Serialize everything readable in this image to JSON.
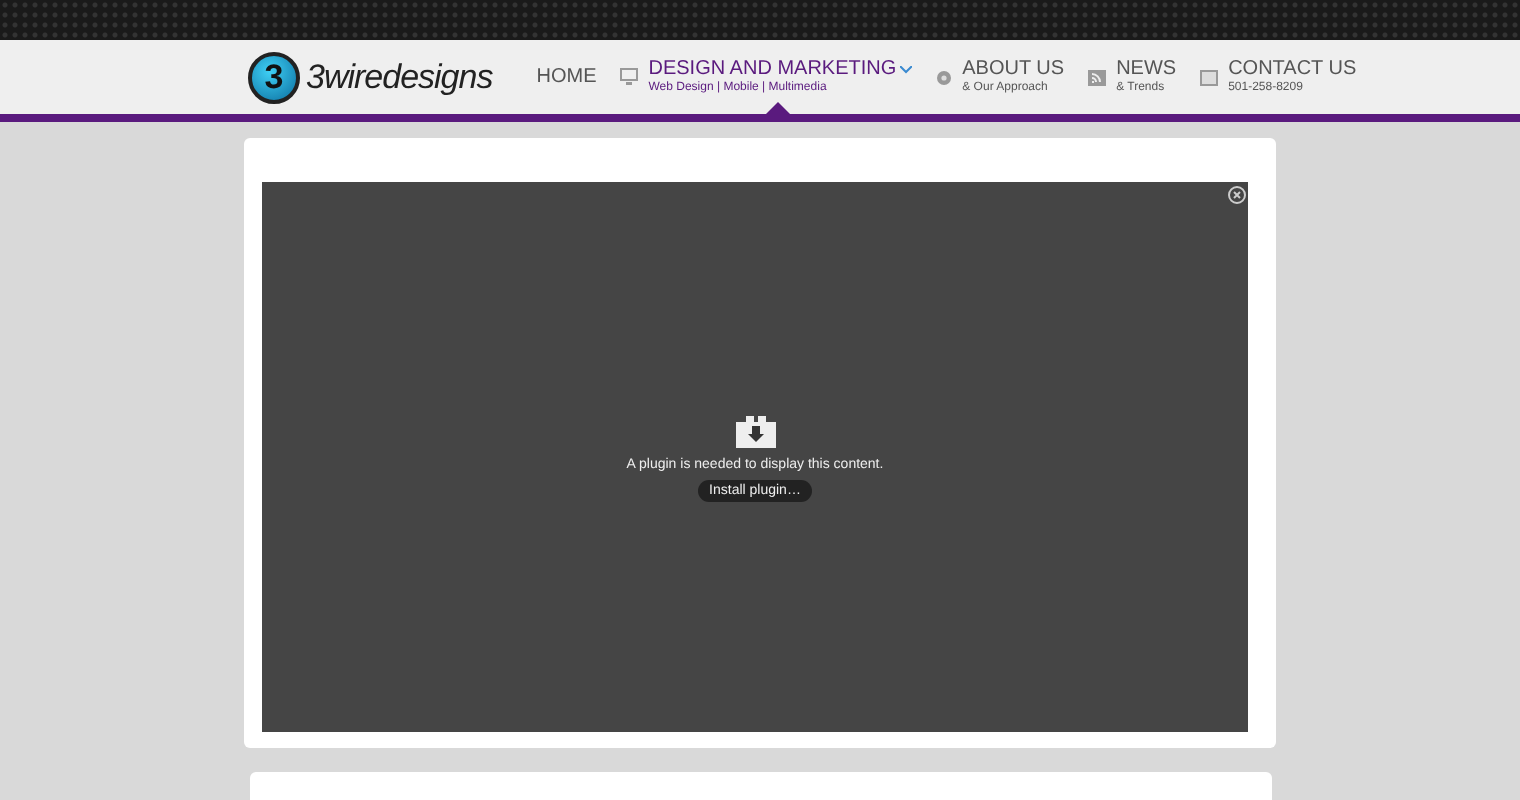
{
  "logo": {
    "mark": "3",
    "text": "3wiredesigns"
  },
  "nav": [
    {
      "label": "HOME",
      "selected": false,
      "dropdown": false
    },
    {
      "label": "DESIGN AND MARKETING",
      "sub": "Web Design | Mobile | Multimedia",
      "selected": true,
      "dropdown": true
    },
    {
      "label": "ABOUT US",
      "sub": "& Our Approach",
      "selected": false,
      "dropdown": false
    },
    {
      "label": "NEWS",
      "sub": "& Trends",
      "selected": false,
      "dropdown": false
    },
    {
      "label": "CONTACT US",
      "sub": "501-258-8209",
      "selected": false,
      "dropdown": false
    }
  ],
  "plugin": {
    "message": "A plugin is needed to display this content.",
    "button": "Install plugin…"
  }
}
